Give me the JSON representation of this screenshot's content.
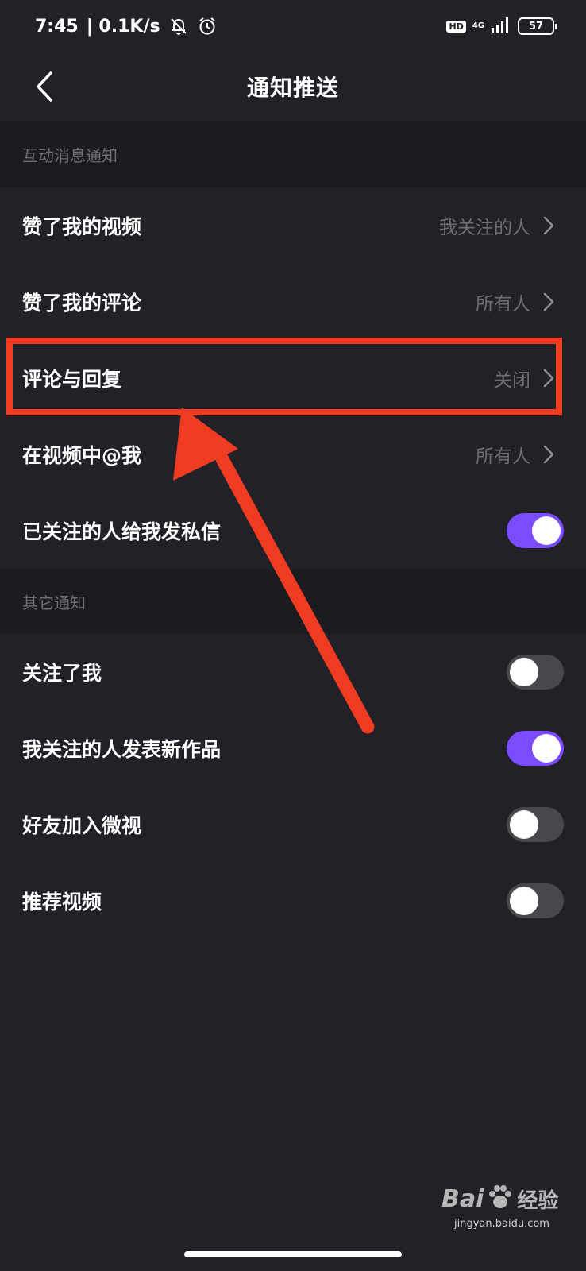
{
  "status_bar": {
    "time": "7:45",
    "speed": "| 0.1K/s",
    "hd": "HD",
    "network": "4G",
    "battery": "57"
  },
  "header": {
    "title": "通知推送"
  },
  "sections": {
    "interaction_title": "互动消息通知",
    "other_title": "其它通知"
  },
  "rows": {
    "liked_video": {
      "label": "赞了我的视频",
      "value": "我关注的人"
    },
    "liked_comment": {
      "label": "赞了我的评论",
      "value": "所有人"
    },
    "comment_reply": {
      "label": "评论与回复",
      "value": "关闭"
    },
    "mentioned": {
      "label": "在视频中@我",
      "value": "所有人"
    },
    "private_message": {
      "label": "已关注的人给我发私信",
      "toggle_on": true
    },
    "followed_me": {
      "label": "关注了我",
      "toggle_on": false
    },
    "new_works": {
      "label": "我关注的人发表新作品",
      "toggle_on": true
    },
    "friend_joined": {
      "label": "好友加入微视",
      "toggle_on": false
    },
    "recommended": {
      "label": "推荐视频",
      "toggle_on": false
    }
  },
  "watermark": {
    "brand": "Bai",
    "brand_cn": "经验",
    "url": "jingyan.baidu.com"
  },
  "colors": {
    "background": "#222127",
    "section_background": "#1c1b20",
    "accent": "#7b4bff",
    "annotation": "#ee3b22",
    "secondary_text": "#6e6d74"
  }
}
